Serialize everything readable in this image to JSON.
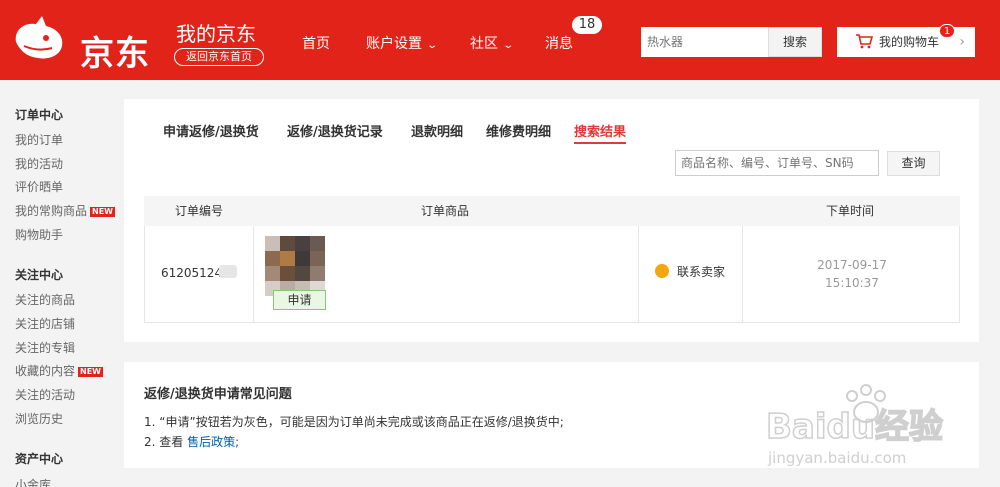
{
  "header": {
    "logo_text": "京东",
    "title": "我的京东",
    "back_home": "返回京东首页",
    "nav": [
      {
        "label": "首页"
      },
      {
        "label": "账户设置"
      },
      {
        "label": "社区"
      },
      {
        "label": "消息"
      }
    ],
    "message_count": "18",
    "search_placeholder": "热水器",
    "search_button": "搜索",
    "cart_label": "我的购物车",
    "cart_count": "1"
  },
  "sidebar": {
    "sections": [
      {
        "title": "订单中心",
        "items": [
          "我的订单",
          "我的活动",
          "评价晒单",
          "我的常购商品",
          "购物助手"
        ]
      },
      {
        "title": "关注中心",
        "items": [
          "关注的商品",
          "关注的店铺",
          "关注的专辑",
          "收藏的内容",
          "关注的活动",
          "浏览历史"
        ]
      },
      {
        "title": "资产中心",
        "items": [
          "小金库"
        ]
      }
    ],
    "new_tag": "NEW"
  },
  "main": {
    "tabs": [
      "申请返修/退换货",
      "返修/退换货记录",
      "退款明细",
      "维修费明细",
      "搜索结果"
    ],
    "active_tab": "搜索结果",
    "search_placeholder": "商品名称、编号、订单号、SN码",
    "query_button": "查询",
    "table": {
      "headers": [
        "订单编号",
        "订单商品",
        "下单时间"
      ],
      "rows": [
        {
          "order_no": "61205124",
          "apply_button": "申请",
          "contact": "联系卖家",
          "date": "2017-09-17",
          "time": "15:10:37"
        }
      ]
    }
  },
  "faq": {
    "title": "返修/退换货申请常见问题",
    "line1": "1. “申请”按钮若为灰色，可能是因为订单尚未完成或该商品正在返修/退换货中;",
    "line2_prefix": "2. 查看",
    "line2_link": "售后政策;"
  },
  "watermark": {
    "brand": "Baidu经验",
    "url": "jingyan.baidu.com"
  },
  "colors": {
    "brand_red": "#e2231a",
    "link_blue": "#005ea7",
    "active_tab": "#e4393c"
  }
}
